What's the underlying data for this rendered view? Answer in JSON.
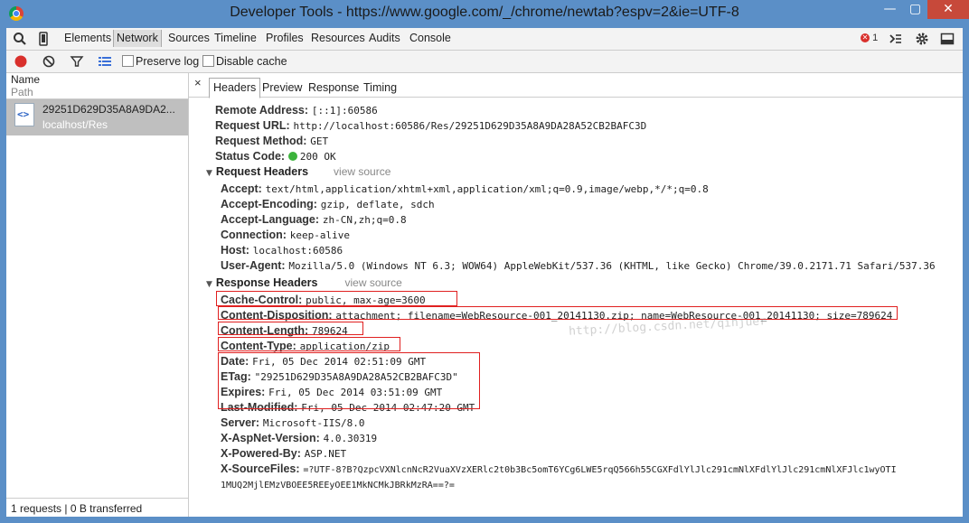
{
  "window": {
    "title": "Developer Tools - https://www.google.com/_/chrome/newtab?espv=2&ie=UTF-8",
    "min": "—",
    "max": "▢",
    "close": "✕"
  },
  "toolbar": {
    "tabs": [
      "Elements",
      "Network",
      "Sources",
      "Timeline",
      "Profiles",
      "Resources",
      "Audits",
      "Console"
    ],
    "active_tab": "Network",
    "error_count": "1"
  },
  "net_toolbar": {
    "preserve_log": "Preserve log",
    "disable_cache": "Disable cache"
  },
  "list": {
    "col_name": "Name",
    "col_path": "Path",
    "file_name": "29251D629D35A8A9DA2...",
    "file_path": "localhost/Res",
    "status": "1 requests | 0 B transferred"
  },
  "detail": {
    "close": "×",
    "tabs": [
      "Headers",
      "Preview",
      "Response",
      "Timing"
    ],
    "active_tab": "Headers",
    "general": [
      {
        "k": "Remote Address:",
        "v": "[::1]:60586"
      },
      {
        "k": "Request URL:",
        "v": "http://localhost:60586/Res/29251D629D35A8A9DA28A52CB2BAFC3D"
      },
      {
        "k": "Request Method:",
        "v": "GET"
      },
      {
        "k": "Status Code:",
        "v": "200 OK"
      }
    ],
    "request_headers_title": "Request Headers",
    "response_headers_title": "Response Headers",
    "view_source": "view source",
    "request_headers": [
      {
        "k": "Accept:",
        "v": "text/html,application/xhtml+xml,application/xml;q=0.9,image/webp,*/*;q=0.8"
      },
      {
        "k": "Accept-Encoding:",
        "v": "gzip, deflate, sdch"
      },
      {
        "k": "Accept-Language:",
        "v": "zh-CN,zh;q=0.8"
      },
      {
        "k": "Connection:",
        "v": "keep-alive"
      },
      {
        "k": "Host:",
        "v": "localhost:60586"
      },
      {
        "k": "User-Agent:",
        "v": "Mozilla/5.0 (Windows NT 6.3; WOW64) AppleWebKit/537.36 (KHTML, like Gecko) Chrome/39.0.2171.71 Safari/537.36"
      }
    ],
    "response_headers": [
      {
        "k": "Cache-Control:",
        "v": "public, max-age=3600"
      },
      {
        "k": "Content-Disposition:",
        "v": "attachment; filename=WebResource-001_20141130.zip; name=WebResource-001_20141130; size=789624"
      },
      {
        "k": "Content-Length:",
        "v": "789624"
      },
      {
        "k": "Content-Type:",
        "v": "application/zip"
      },
      {
        "k": "Date:",
        "v": "Fri, 05 Dec 2014 02:51:09 GMT"
      },
      {
        "k": "ETag:",
        "v": "\"29251D629D35A8A9DA28A52CB2BAFC3D\""
      },
      {
        "k": "Expires:",
        "v": "Fri, 05 Dec 2014 03:51:09 GMT"
      },
      {
        "k": "Last-Modified:",
        "v": "Fri, 05 Dec 2014 02:47:20 GMT"
      },
      {
        "k": "Server:",
        "v": "Microsoft-IIS/8.0"
      },
      {
        "k": "X-AspNet-Version:",
        "v": "4.0.30319"
      },
      {
        "k": "X-Powered-By:",
        "v": "ASP.NET"
      },
      {
        "k": "X-SourceFiles:",
        "v": "=?UTF-8?B?QzpcVXNlcnNcR2VuaXVzXERlc2t0b3Bc5omT6YCg6LWE5rqQ566h55CGXFdlYlJlc291cmNlXFdlYlJlc291cmNlXFJlc1wyOTI"
      },
      {
        "k": "",
        "v": "1MUQ2MjlEMzVBOEE5REEyOEE1MkNCMkJBRkMzRA==?="
      }
    ],
    "watermark": "http://blog.csdn.net/qinjuer"
  },
  "colors": {
    "titlebar": "#5b8fc7",
    "close": "#c7493a",
    "highlight": "#e02020",
    "selected_row": "#bfbfbf"
  }
}
